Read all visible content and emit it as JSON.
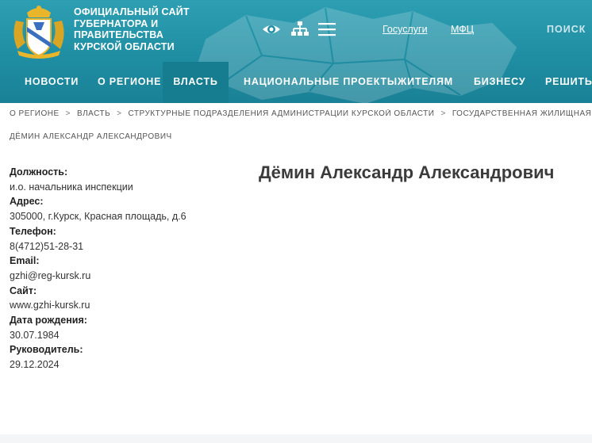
{
  "header": {
    "site_title_lines": [
      "ОФИЦИАЛЬНЫЙ САЙТ",
      "ГУБЕРНАТОРА И",
      "ПРАВИТЕЛЬСТВА",
      "КУРСКОЙ ОБЛАСТИ"
    ],
    "links": {
      "gosuslugi": "Госуслуги",
      "mfc": "МФЦ"
    },
    "search_label": "ПОИСК",
    "icons": [
      "eye-icon",
      "sitemap-icon",
      "menu-icon"
    ]
  },
  "nav": {
    "items": [
      "НОВОСТИ",
      "О РЕГИОНЕ",
      "ВЛАСТЬ",
      "НАЦИОНАЛЬНЫЕ ПРОЕКТЫ",
      "ЖИТЕЛЯМ",
      "БИЗНЕСУ",
      "РЕШИТЬ ПРОБЛЕМУ"
    ],
    "active": "ВЛАСТЬ"
  },
  "breadcrumb": {
    "items": [
      "О РЕГИОНЕ",
      "ВЛАСТЬ",
      "СТРУКТУРНЫЕ ПОДРАЗДЕЛЕНИЯ АДМИНИСТРАЦИИ КУРСКОЙ ОБЛАСТИ",
      "ГОСУДАРСТВЕННАЯ ЖИЛИЩНАЯ ИНСПЕКЦИЯ КУРСКОЙ ОБЛАСТИ"
    ],
    "separator": ">",
    "current": "ДЁМИН АЛЕКСАНДР АЛЕКСАНДРОВИЧ"
  },
  "person": {
    "name": "Дёмин Александр Александрович",
    "fields": [
      {
        "label": "Должность:",
        "value": "и.о. начальника инспекции"
      },
      {
        "label": "Адрес:",
        "value": "305000, г.Курск, Красная площадь, д.6"
      },
      {
        "label": "Телефон:",
        "value": "8(4712)51-28-31"
      },
      {
        "label": "Email:",
        "value": "gzhi@reg-kursk.ru"
      },
      {
        "label": "Сайт:",
        "value": "www.gzhi-kursk.ru"
      },
      {
        "label": "Дата рождения:",
        "value": "30.07.1984"
      },
      {
        "label": "Руководитель:",
        "value": "29.12.2024"
      }
    ]
  },
  "colors": {
    "header": "#2e9fb3",
    "nav_active": "#167c90",
    "emblem_gold": "#e9b62b",
    "emblem_blue": "#3a6fc0"
  }
}
